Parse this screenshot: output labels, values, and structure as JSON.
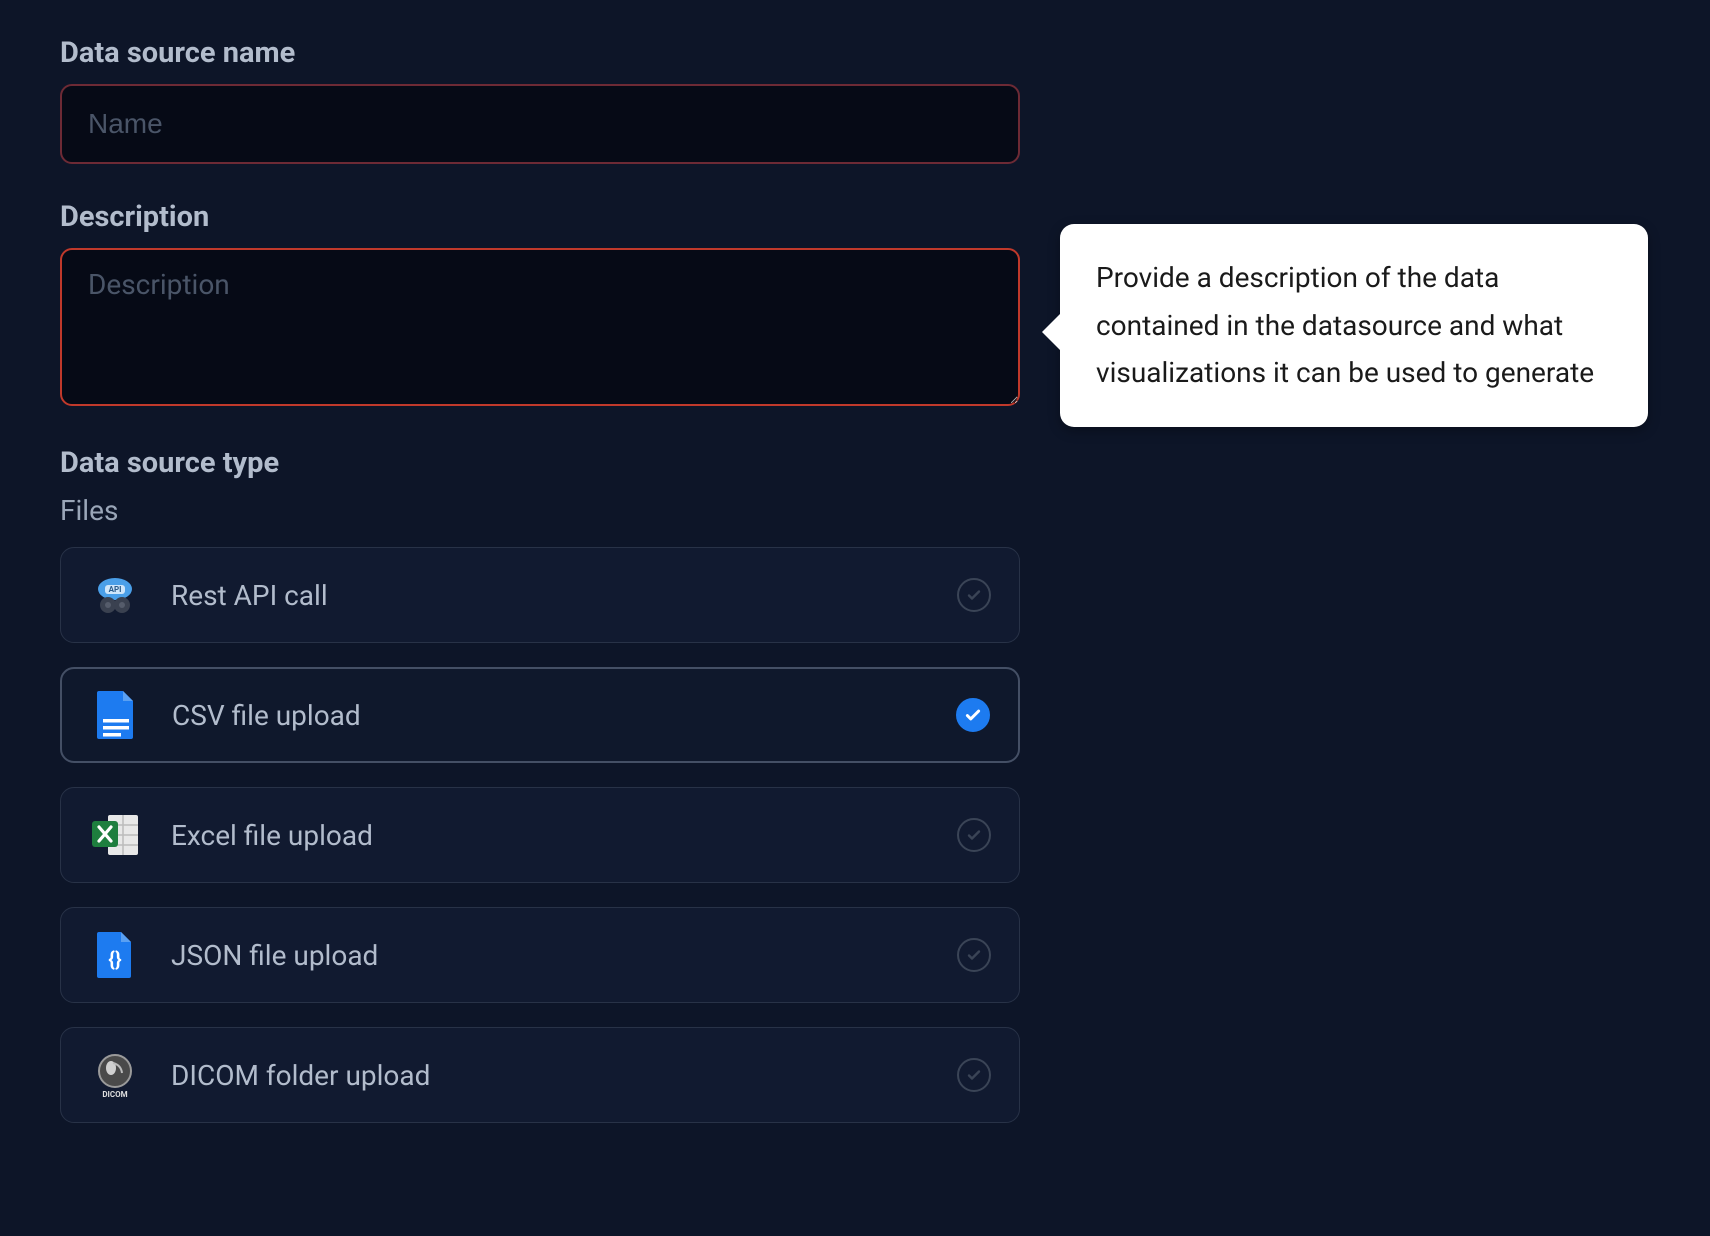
{
  "form": {
    "name_label": "Data source name",
    "name_placeholder": "Name",
    "name_value": "",
    "description_label": "Description",
    "description_placeholder": "Description",
    "description_value": "",
    "type_label": "Data source type",
    "files_label": "Files",
    "options": [
      {
        "label": "Rest API call",
        "icon": "api",
        "selected": false
      },
      {
        "label": "CSV file upload",
        "icon": "csv",
        "selected": true
      },
      {
        "label": "Excel file upload",
        "icon": "excel",
        "selected": false
      },
      {
        "label": "JSON file upload",
        "icon": "json",
        "selected": false
      },
      {
        "label": "DICOM folder upload",
        "icon": "dicom",
        "selected": false
      }
    ]
  },
  "tooltip": {
    "text": "Provide a description of the data contained in the datasource and what visualizations it can be used to generate"
  },
  "colors": {
    "bg": "#0d1528",
    "input_border_error": "#c0392b",
    "accent": "#1d7bf0"
  }
}
